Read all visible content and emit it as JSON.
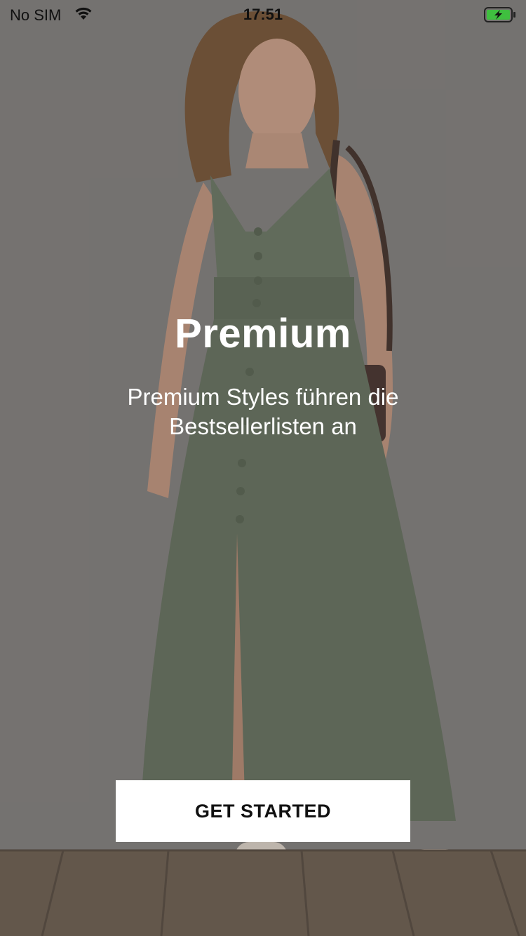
{
  "status_bar": {
    "carrier": "No SIM",
    "time": "17:51",
    "icons": [
      "wifi-icon",
      "battery-charging-icon"
    ],
    "battery_color": "#3fbf3f"
  },
  "hero": {
    "background_image": "woman-in-sage-green-maxi-dress-photo",
    "dress_color": "#6f7a68",
    "overlay_color": "#00000033"
  },
  "content": {
    "title": "Premium",
    "subtitle": "Premium Styles führen die Bestsellerlisten an"
  },
  "cta": {
    "label": "GET STARTED"
  }
}
